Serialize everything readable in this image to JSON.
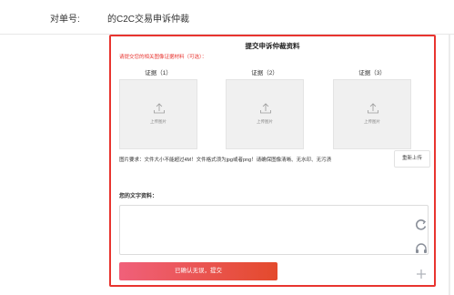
{
  "order": {
    "label": "对单号:",
    "value": "的C2C交易申诉仲裁"
  },
  "panel": {
    "title": "提交申诉仲裁资料",
    "hint": "请提交您的相关图像证据材料（可选）：",
    "evidence": [
      {
        "label": "证据（1）",
        "upload_text": "上传图片"
      },
      {
        "label": "证据（2）",
        "upload_text": "上传图片"
      },
      {
        "label": "证据（3）",
        "upload_text": "上传图片"
      }
    ],
    "requirements": "图片要求：文件大小不能超过4M！文件格式须为jpg或者png！请确保图像清晰、无水印、无污渍",
    "reupload_label": "重新上传",
    "text_label": "您的文字资料：",
    "text_value": "",
    "submit_label": "已确认无误，提交"
  },
  "colors": {
    "accent": "#e8342f",
    "submit_start": "#f0607a",
    "submit_end": "#e44a2c"
  },
  "icons": [
    "upload-icon",
    "refresh-icon",
    "headset-icon",
    "plus-icon"
  ]
}
